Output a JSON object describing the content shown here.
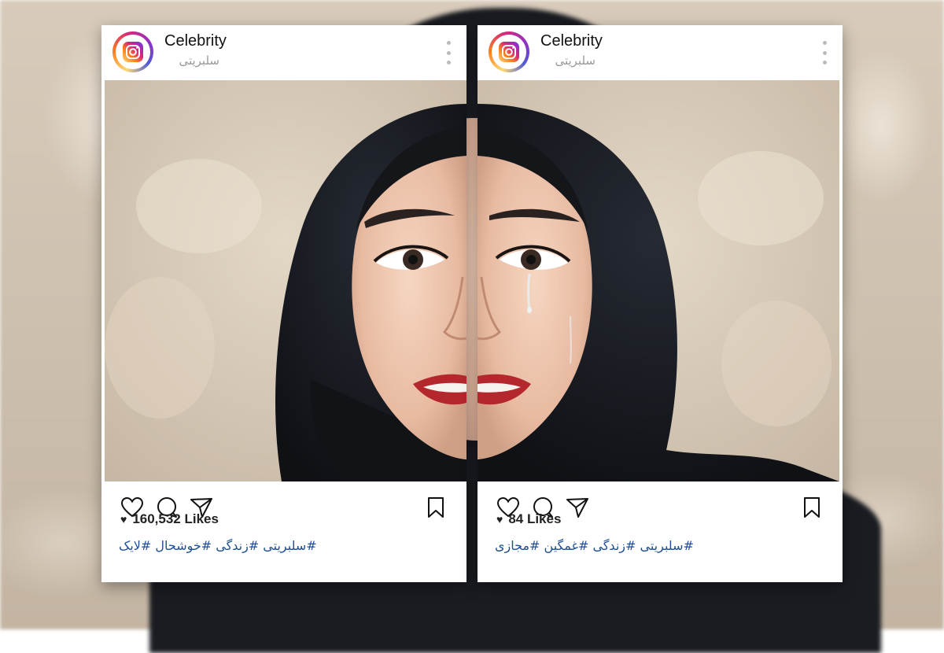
{
  "posts": [
    {
      "username": "Celebrity",
      "subname": "سلبریتی",
      "likes": "160,532 Likes",
      "hashtags": "#سلبریتی #زندگی #خوشحال #لایک",
      "mood": "smiling"
    },
    {
      "username": "Celebrity",
      "subname": "سلبریتی",
      "likes": "84 Likes",
      "hashtags": "#سلبریتی #زندگی #غمگین #مجازی",
      "mood": "crying"
    }
  ],
  "icons": {
    "avatar": "instagram-logo-icon",
    "more": "more-vertical-icon",
    "like": "heart-icon",
    "comment": "comment-icon",
    "share": "send-icon",
    "save": "bookmark-icon",
    "likes_prefix": "heart-small-icon"
  },
  "colors": {
    "hashtag": "#1f4f95",
    "card_bg": "#ffffff",
    "hijab": "#15171c",
    "lipstick": "#b3272d"
  }
}
